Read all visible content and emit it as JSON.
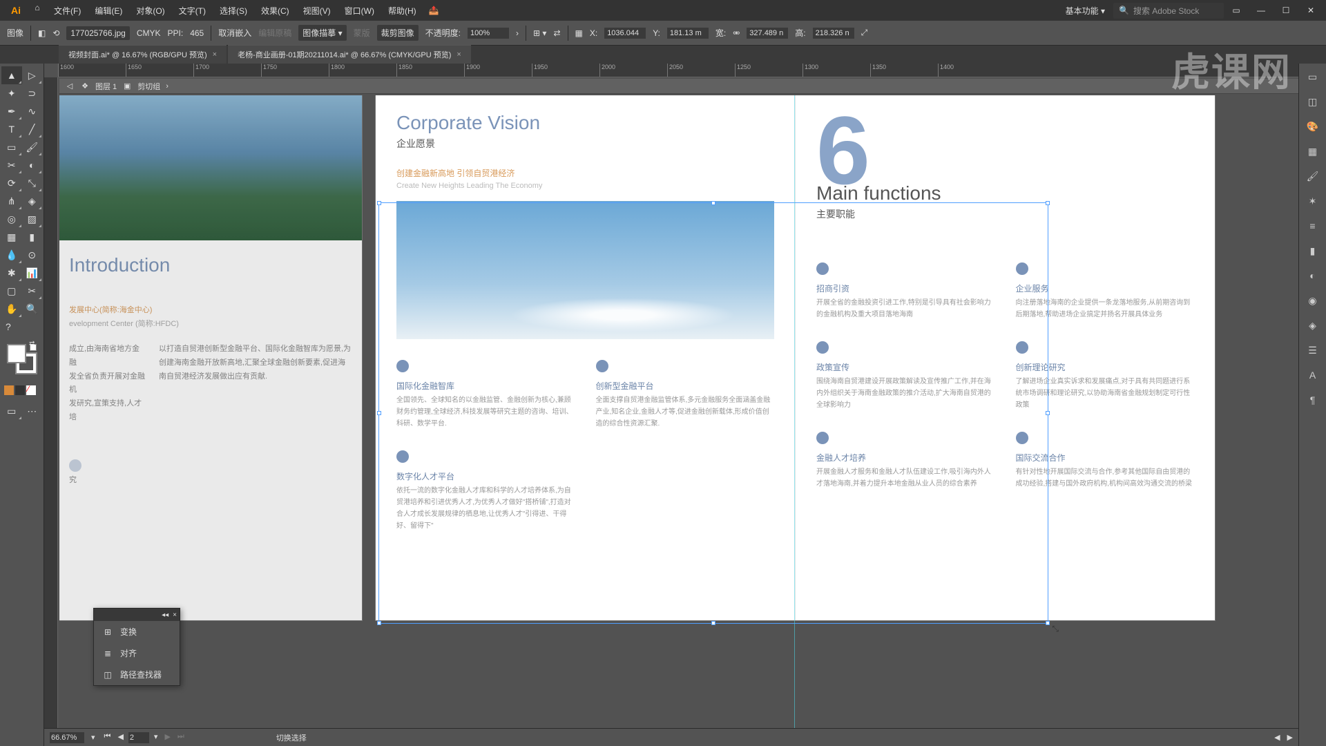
{
  "menubar": {
    "file": "文件(F)",
    "edit": "编辑(E)",
    "object": "对象(O)",
    "type": "文字(T)",
    "select": "选择(S)",
    "effect": "效果(C)",
    "view": "视图(V)",
    "window": "窗口(W)",
    "help": "帮助(H)"
  },
  "workspace_label": "基本功能",
  "search_placeholder": "搜索 Adobe Stock",
  "control": {
    "selection": "图像",
    "filename": "177025766.jpg",
    "colormode": "CMYK",
    "ppi_label": "PPI:",
    "ppi": "465",
    "cancel_embed": "取消嵌入",
    "edit_original": "编辑原稿",
    "image_trace": "图像描摹",
    "mask": "蒙版",
    "crop": "裁剪图像",
    "opacity_label": "不透明度:",
    "opacity": "100%",
    "x_label": "X:",
    "x": "1036.044",
    "y_label": "Y:",
    "y": "181.13 m",
    "w_label": "宽:",
    "w": "327.489 n",
    "h_label": "高:",
    "h": "218.326 n"
  },
  "tabs": [
    {
      "label": "视频封面.ai* @ 16.67% (RGB/GPU 预览)"
    },
    {
      "label": "老杨-商业画册-01期20211014.ai* @ 66.67% (CMYK/GPU 预览)"
    }
  ],
  "breadcrumb": {
    "layer": "图层 1",
    "clip": "剪切组"
  },
  "ruler_ticks": [
    "1600",
    "1650",
    "1700",
    "1750",
    "1800",
    "1850",
    "1900",
    "1950",
    "2000",
    "2050",
    "1250",
    "1300",
    "1350",
    "1400"
  ],
  "page_left": {
    "title": "Introduction",
    "sub1": "发展中心(简称:海金中心)",
    "sub2": "evelopment Center (简称:HFDC)",
    "p1": "成立,由海南省地方金融",
    "p2": "以打造自贸港创新型金融平台、国际化金融智库为愿景,为",
    "p3": "发全省负责开展对金融机",
    "p4": "创建海南金融开放新高地,汇聚全球金融创新要素,促进海",
    "p5": "发研究,宣策支持,人才培",
    "p6": "南自贸港经济发展做出应有贡献.",
    "p7": "究"
  },
  "page_mid": {
    "h1": "Corporate Vision",
    "h2": "企业愿景",
    "slog_cn": "创建金融新高地 引领自贸港经济",
    "slog_en": "Create New Heights Leading The Economy",
    "items": [
      {
        "t": "国际化金融智库",
        "d": "全国领先、全球知名的以金融监管、金融创新为核心,兼顾财务约管理,全球经济,科技发展等研究主题的咨询、培训、科研、数学平台."
      },
      {
        "t": "创新型金融平台",
        "d": "全面支撑自贸港金融监管体系,多元金融服务全面涵盖金融产业,知名企业,金融人才等,促进金融创新载体,形成价值创造的综合性资源汇聚."
      },
      {
        "t": "数字化人才平台",
        "d": "依托一流的数字化金融人才库和科学的人才培养体系,为自贸港培养和引进优秀人才,为优秀人才做好\"搭桥铺\",打造对合人才成长发展规律的栖息地,让优秀人才\"引得进、干得好、留得下\""
      }
    ]
  },
  "page_right": {
    "num": "6",
    "h1": "Main functions",
    "h2": "主要职能",
    "items": [
      {
        "t": "招商引资",
        "d": "开展全省的金融投资引进工作,特别是引导具有社会影响力的金融机构及重大项目落地海南"
      },
      {
        "t": "企业服务",
        "d": "向注册落地海南的企业提供一条龙落地服务,从前期咨询到后期落地,帮助进场企业搞定并扬名开展具体业务"
      },
      {
        "t": "政策宣传",
        "d": "围绕海南自贸港建设开展政策解读及宣传推广工作,并在海内外组织关于海南金融政策的推介活动,扩大海南自贸港的全球影响力"
      },
      {
        "t": "创新理论研究",
        "d": "了解进场企业真实诉求和发展痛点,对于具有共同题进行系统市场调研和理论研究,以协助海南省金融规划制定可行性政策"
      },
      {
        "t": "金融人才培养",
        "d": "开展金融人才服务和金融人才队伍建设工作,吸引海内外人才落地海南,并着力提升本地金融从业人员的综合素养"
      },
      {
        "t": "国际交流合作",
        "d": "有针对性地开展国际交流与合作,参考其他国际自由贸港的成功经验,搭建与国外政府机构,机构间高效沟通交流的桥梁"
      }
    ]
  },
  "float": {
    "transform": "变换",
    "align": "对齐",
    "pathfinder": "路径查找器"
  },
  "status": {
    "zoom": "66.67%",
    "page": "2",
    "switch": "切换选择"
  }
}
